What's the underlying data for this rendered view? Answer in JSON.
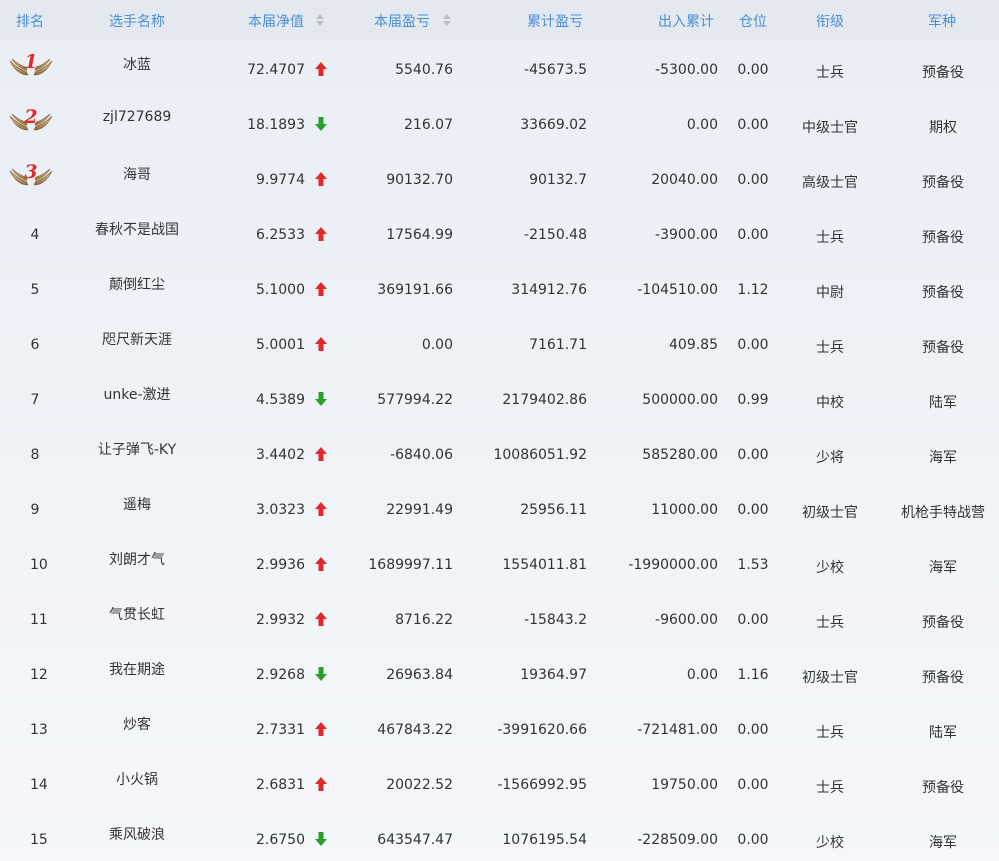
{
  "header": {
    "rank": "排名",
    "name": "选手名称",
    "net_value": "本届净值",
    "profit": "本届盈亏",
    "total_profit": "累计盈亏",
    "flow": "出入累计",
    "position": "仓位",
    "military_rank": "衔级",
    "arm": "军种"
  },
  "colors": {
    "header_text": "#4a90d9",
    "up_arrow": "#e02a2a",
    "down_arrow": "#2aa02a",
    "medal_number": "#e02a2a"
  },
  "rows": [
    {
      "rank": "1",
      "medal": true,
      "name": "冰蓝",
      "net": "72.4707",
      "trend": "up",
      "profit": "5540.76",
      "total": "-45673.5",
      "flow": "-5300.00",
      "pos": "0.00",
      "mil": "士兵",
      "arm": "预备役"
    },
    {
      "rank": "2",
      "medal": true,
      "name": "zjl727689",
      "net": "18.1893",
      "trend": "down",
      "profit": "216.07",
      "total": "33669.02",
      "flow": "0.00",
      "pos": "0.00",
      "mil": "中级士官",
      "arm": "期权"
    },
    {
      "rank": "3",
      "medal": true,
      "name": "海哥",
      "net": "9.9774",
      "trend": "up",
      "profit": "90132.70",
      "total": "90132.7",
      "flow": "20040.00",
      "pos": "0.00",
      "mil": "高级士官",
      "arm": "预备役"
    },
    {
      "rank": "4",
      "medal": false,
      "name": "春秋不是战国",
      "net": "6.2533",
      "trend": "up",
      "profit": "17564.99",
      "total": "-2150.48",
      "flow": "-3900.00",
      "pos": "0.00",
      "mil": "士兵",
      "arm": "预备役"
    },
    {
      "rank": "5",
      "medal": false,
      "name": "颠倒红尘",
      "net": "5.1000",
      "trend": "up",
      "profit": "369191.66",
      "total": "314912.76",
      "flow": "-104510.00",
      "pos": "1.12",
      "mil": "中尉",
      "arm": "预备役"
    },
    {
      "rank": "6",
      "medal": false,
      "name": "咫尺新天涯",
      "net": "5.0001",
      "trend": "up",
      "profit": "0.00",
      "total": "7161.71",
      "flow": "409.85",
      "pos": "0.00",
      "mil": "士兵",
      "arm": "预备役"
    },
    {
      "rank": "7",
      "medal": false,
      "name": "unke-激进",
      "net": "4.5389",
      "trend": "down",
      "profit": "577994.22",
      "total": "2179402.86",
      "flow": "500000.00",
      "pos": "0.99",
      "mil": "中校",
      "arm": "陆军"
    },
    {
      "rank": "8",
      "medal": false,
      "name": "让子弹飞-KY",
      "net": "3.4402",
      "trend": "up",
      "profit": "-6840.06",
      "total": "10086051.92",
      "flow": "585280.00",
      "pos": "0.00",
      "mil": "少将",
      "arm": "海军"
    },
    {
      "rank": "9",
      "medal": false,
      "name": "遥梅",
      "net": "3.0323",
      "trend": "up",
      "profit": "22991.49",
      "total": "25956.11",
      "flow": "11000.00",
      "pos": "0.00",
      "mil": "初级士官",
      "arm": "机枪手特战营"
    },
    {
      "rank": "10",
      "medal": false,
      "name": "刘朗才气",
      "net": "2.9936",
      "trend": "up",
      "profit": "1689997.11",
      "total": "1554011.81",
      "flow": "-1990000.00",
      "pos": "1.53",
      "mil": "少校",
      "arm": "海军"
    },
    {
      "rank": "11",
      "medal": false,
      "name": "气贯长虹",
      "net": "2.9932",
      "trend": "up",
      "profit": "8716.22",
      "total": "-15843.2",
      "flow": "-9600.00",
      "pos": "0.00",
      "mil": "士兵",
      "arm": "预备役"
    },
    {
      "rank": "12",
      "medal": false,
      "name": "我在期途",
      "net": "2.9268",
      "trend": "down",
      "profit": "26963.84",
      "total": "19364.97",
      "flow": "0.00",
      "pos": "1.16",
      "mil": "初级士官",
      "arm": "预备役"
    },
    {
      "rank": "13",
      "medal": false,
      "name": "炒客",
      "net": "2.7331",
      "trend": "up",
      "profit": "467843.22",
      "total": "-3991620.66",
      "flow": "-721481.00",
      "pos": "0.00",
      "mil": "士兵",
      "arm": "陆军"
    },
    {
      "rank": "14",
      "medal": false,
      "name": "小火锅",
      "net": "2.6831",
      "trend": "up",
      "profit": "20022.52",
      "total": "-1566992.95",
      "flow": "19750.00",
      "pos": "0.00",
      "mil": "士兵",
      "arm": "预备役"
    },
    {
      "rank": "15",
      "medal": false,
      "name": "乘风破浪",
      "net": "2.6750",
      "trend": "down",
      "profit": "643547.47",
      "total": "1076195.54",
      "flow": "-228509.00",
      "pos": "0.00",
      "mil": "少校",
      "arm": "海军"
    }
  ]
}
